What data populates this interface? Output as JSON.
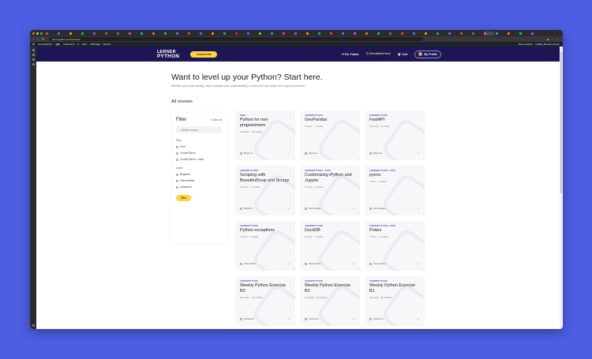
{
  "browser": {
    "url": "lernerpython.com/courses/",
    "tabs": [
      "",
      "",
      "",
      "",
      "",
      "",
      "",
      "",
      "",
      "",
      "",
      "",
      "",
      "",
      "",
      "",
      "",
      "",
      "",
      "",
      "",
      "",
      "",
      "",
      "",
      "",
      "",
      "",
      "",
      "",
      "",
      "",
      "",
      "",
      "",
      "",
      "",
      "",
      "",
      "",
      "",
      ""
    ],
    "profile_label": "",
    "tab_colors": [
      "#e8453c",
      "#3b82f6",
      "#f59e0b",
      "#10b981",
      "#8b5cf6",
      "#ef4444",
      "#6b7280",
      "#ec4899",
      "#06b6d4",
      "#f97316",
      "#22c55e",
      "#a855f7",
      "#ef4444",
      "#3b82f6",
      "#f59e0b",
      "#14b8a6",
      "#e11d48",
      "#6366f1",
      "#84cc16",
      "#0ea5e9",
      "#f43f5e",
      "#8b5cf6",
      "#f59e0b",
      "#10b981",
      "#ef4444",
      "#3b82f6",
      "#d946ef",
      "#f97316",
      "#22c55e",
      "#6b7280",
      "#e8453c",
      "#3b82f6",
      "#f59e0b",
      "#10b981",
      "#8b5cf6",
      "#ef4444",
      "#6b7280",
      "#ec4899",
      "#06b6d4",
      "#f97316",
      "#22c55e",
      "#a855f7"
    ]
  },
  "wp_admin_bar": {
    "site": "LernerPython",
    "counts": "228",
    "customize": "Customize",
    "comments": "0",
    "new": "New",
    "seo": "228 Page",
    "events": "Events",
    "right_items": [
      "Clear Caches",
      "Howdy, Reuven Lerner"
    ]
  },
  "site_header": {
    "logo_line1": "LERNER",
    "logo_line2": "PYTHON",
    "course_list_button": "Course list",
    "nav": {
      "for_teams": "For Teams",
      "get_started": "Get started here",
      "cart": "Cart",
      "my_profile": "My Profile"
    }
  },
  "page": {
    "heading": "Want to level up your Python? Start here.",
    "subtitle": "Whether you're just starting, want to deepen your understanding, or move into new areas, we've got you covered.",
    "section_title": "All courses"
  },
  "filter": {
    "title": "Filter",
    "clear_all": "Clear all",
    "search_placeholder": "Search course...",
    "plan_label": "Plan",
    "plan_options": [
      "Free",
      "LernerPython",
      "LernerPython + data"
    ],
    "level_label": "Level",
    "level_options": [
      "Beginner",
      "Intermediate",
      "Advanced"
    ],
    "button": "Filter"
  },
  "courses": [
    {
      "tag": "FREE",
      "title": "Python for non-programmers",
      "meta": "15 weeks · 15 modules",
      "level": "Beginner"
    },
    {
      "tag": "LERNERPYTHON",
      "title": "GeoPandas",
      "meta": "1 hours · 1 module",
      "level": "Beginner"
    },
    {
      "tag": "LERNERPYTHON",
      "title": "FastAPI",
      "meta": "2.5 hours · 1 module",
      "level": "Beginner"
    },
    {
      "tag": "LERNERPYTHON",
      "title": "Scraping with BeautifulSoup and Scrapy",
      "meta": "2.5 hours · 1 module",
      "level": "Beginner"
    },
    {
      "tag": "LERNERPYTHON + DATA",
      "title": "Customizing iPython and Jupyter",
      "meta": "1 hours · 1 module",
      "level": "Intermediate"
    },
    {
      "tag": "LERNERPYTHON + DATA",
      "title": "pyenv",
      "meta": "1 hour · 1 module",
      "level": "Intermediate"
    },
    {
      "tag": "LERNERPYTHON",
      "title": "Python exceptions",
      "meta": "2 hours · 1 module",
      "level": "Intermediate"
    },
    {
      "tag": "LERNERPYTHON",
      "title": "DuckDB",
      "meta": "2 hours · 1 module",
      "level": "Intermediate"
    },
    {
      "tag": "LERNERPYTHON + DATA",
      "title": "Polars",
      "meta": "2 hours · 1 module",
      "level": "Intermediate"
    },
    {
      "tag": "LERNERPYTHON",
      "title": "Weekly Python Exercise B3",
      "meta": "15 weeks · 15 modules",
      "level": "Advanced"
    },
    {
      "tag": "LERNERPYTHON",
      "title": "Weekly Python Exercise B2",
      "meta": "15 weeks · 15 modules",
      "level": "Advanced"
    },
    {
      "tag": "LERNERPYTHON",
      "title": "Weekly Python Exercise B1",
      "meta": "15 weeks · 15 modules",
      "level": "Advanced"
    }
  ],
  "status_bar_text": "",
  "colors": {
    "background": "#4d5ee3",
    "header": "#1c1754",
    "accent_yellow": "#ffd43b",
    "tag_purple": "#4a3fd6"
  }
}
